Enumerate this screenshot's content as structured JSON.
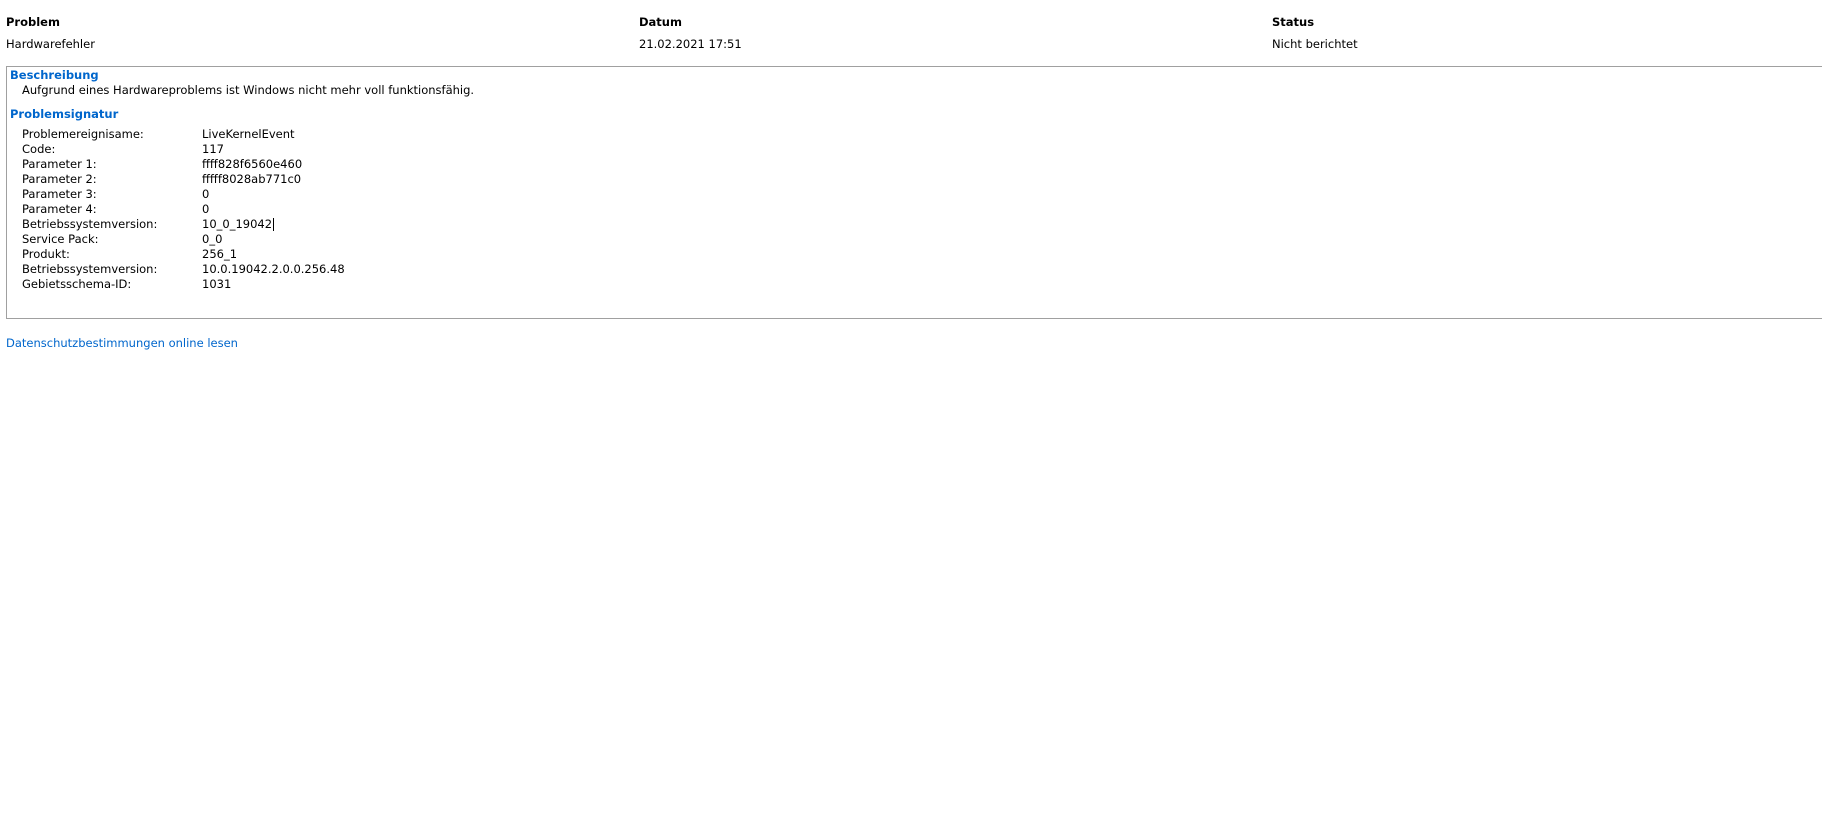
{
  "report_header": {
    "columns": [
      {
        "heading": "Problem",
        "value": "Hardwarefehler"
      },
      {
        "heading": "Datum",
        "value": "21.02.2021 17:51"
      },
      {
        "heading": "Status",
        "value": "Nicht berichtet"
      }
    ]
  },
  "details": {
    "description": {
      "title": "Beschreibung",
      "text": "Aufgrund eines Hardwareproblems ist Windows nicht mehr voll funktionsfähig."
    },
    "signature": {
      "title": "Problemsignatur",
      "rows": [
        {
          "label": "Problemereignisame:",
          "value": "LiveKernelEvent"
        },
        {
          "label": "Code:",
          "value": "117"
        },
        {
          "label": "Parameter 1:",
          "value": "ffff828f6560e460"
        },
        {
          "label": "Parameter 2:",
          "value": "fffff8028ab771c0"
        },
        {
          "label": "Parameter 3:",
          "value": "0"
        },
        {
          "label": "Parameter 4:",
          "value": "0"
        },
        {
          "label": "Betriebssystemversion:",
          "value": "10_0_19042"
        },
        {
          "label": "Service Pack:",
          "value": "0_0"
        },
        {
          "label": "Produkt:",
          "value": "256_1"
        },
        {
          "label": "Betriebssystemversion:",
          "value": "10.0.19042.2.0.0.256.48"
        },
        {
          "label": "Gebietsschema-ID:",
          "value": "1031"
        }
      ]
    }
  },
  "footer": {
    "privacy_link": "Datenschutzbestimmungen online lesen"
  },
  "colors": {
    "link": "#0066cc",
    "border": "#a0a0a0"
  }
}
